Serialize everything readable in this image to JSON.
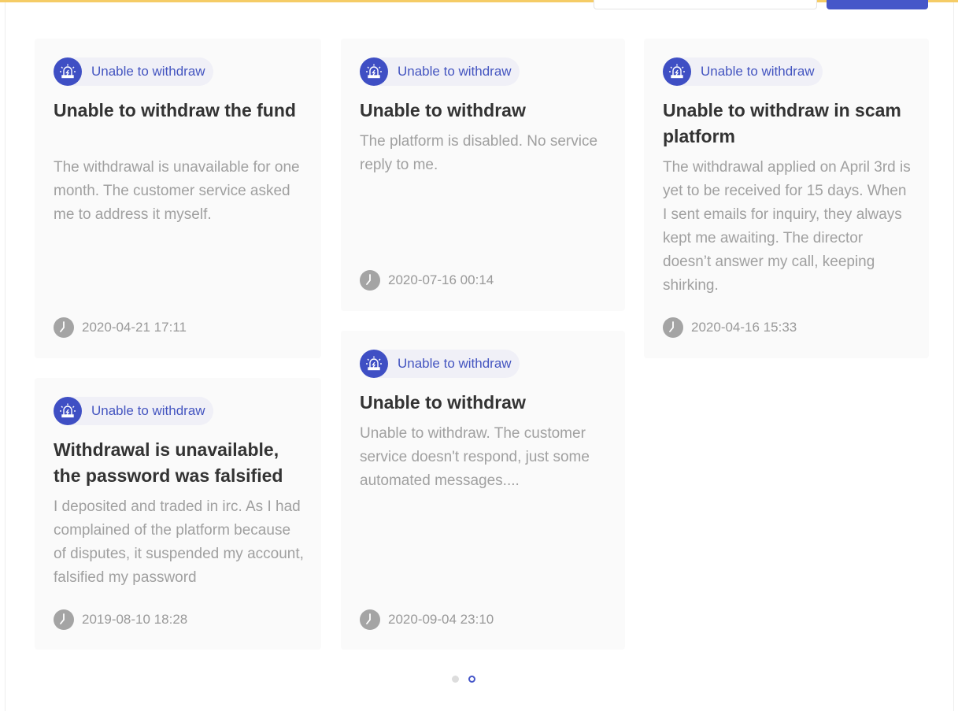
{
  "colors": {
    "accent": "#4657c9",
    "top_border": "#f5cc66",
    "card_bg": "#fafafa",
    "tag_bg": "#f0f0f7",
    "title": "#333333",
    "desc": "#a0a0a0"
  },
  "cards": [
    {
      "tag": "Unable to withdraw",
      "tag_icon": "alarm-icon",
      "title": "Unable to withdraw the fund",
      "desc": "The withdrawal is unavailable for one month. The customer service asked me to address it myself.",
      "time": "2020-04-21 17:11"
    },
    {
      "tag": "Unable to withdraw",
      "tag_icon": "alarm-icon",
      "title": "Unable to withdraw",
      "desc": "The platform is disabled. No service reply to me.",
      "time": "2020-07-16 00:14"
    },
    {
      "tag": "Unable to withdraw",
      "tag_icon": "alarm-icon",
      "title": "Unable to withdraw in scam platform",
      "desc": "The withdrawal applied on April 3rd is yet to be received for 15 days. When I sent emails for inquiry, they always kept me awaiting. The director doesn’t answer my call, keeping shirking.",
      "time": "2020-04-16 15:33"
    },
    {
      "tag": "Unable to withdraw",
      "tag_icon": "alarm-icon",
      "title": "Withdrawal is unavailable, the password was falsified",
      "desc": "I deposited and traded in irc. As I had complained of the platform because of disputes, it suspended my account, falsified my password",
      "time": "2019-08-10 18:28"
    },
    {
      "tag": "Unable to withdraw",
      "tag_icon": "alarm-icon",
      "title": "Unable to withdraw",
      "desc": "Unable to withdraw. The customer service doesn't respond, just some automated messages....",
      "time": "2020-09-04 23:10"
    }
  ],
  "pager": {
    "pages": 2,
    "active_page": 2
  }
}
